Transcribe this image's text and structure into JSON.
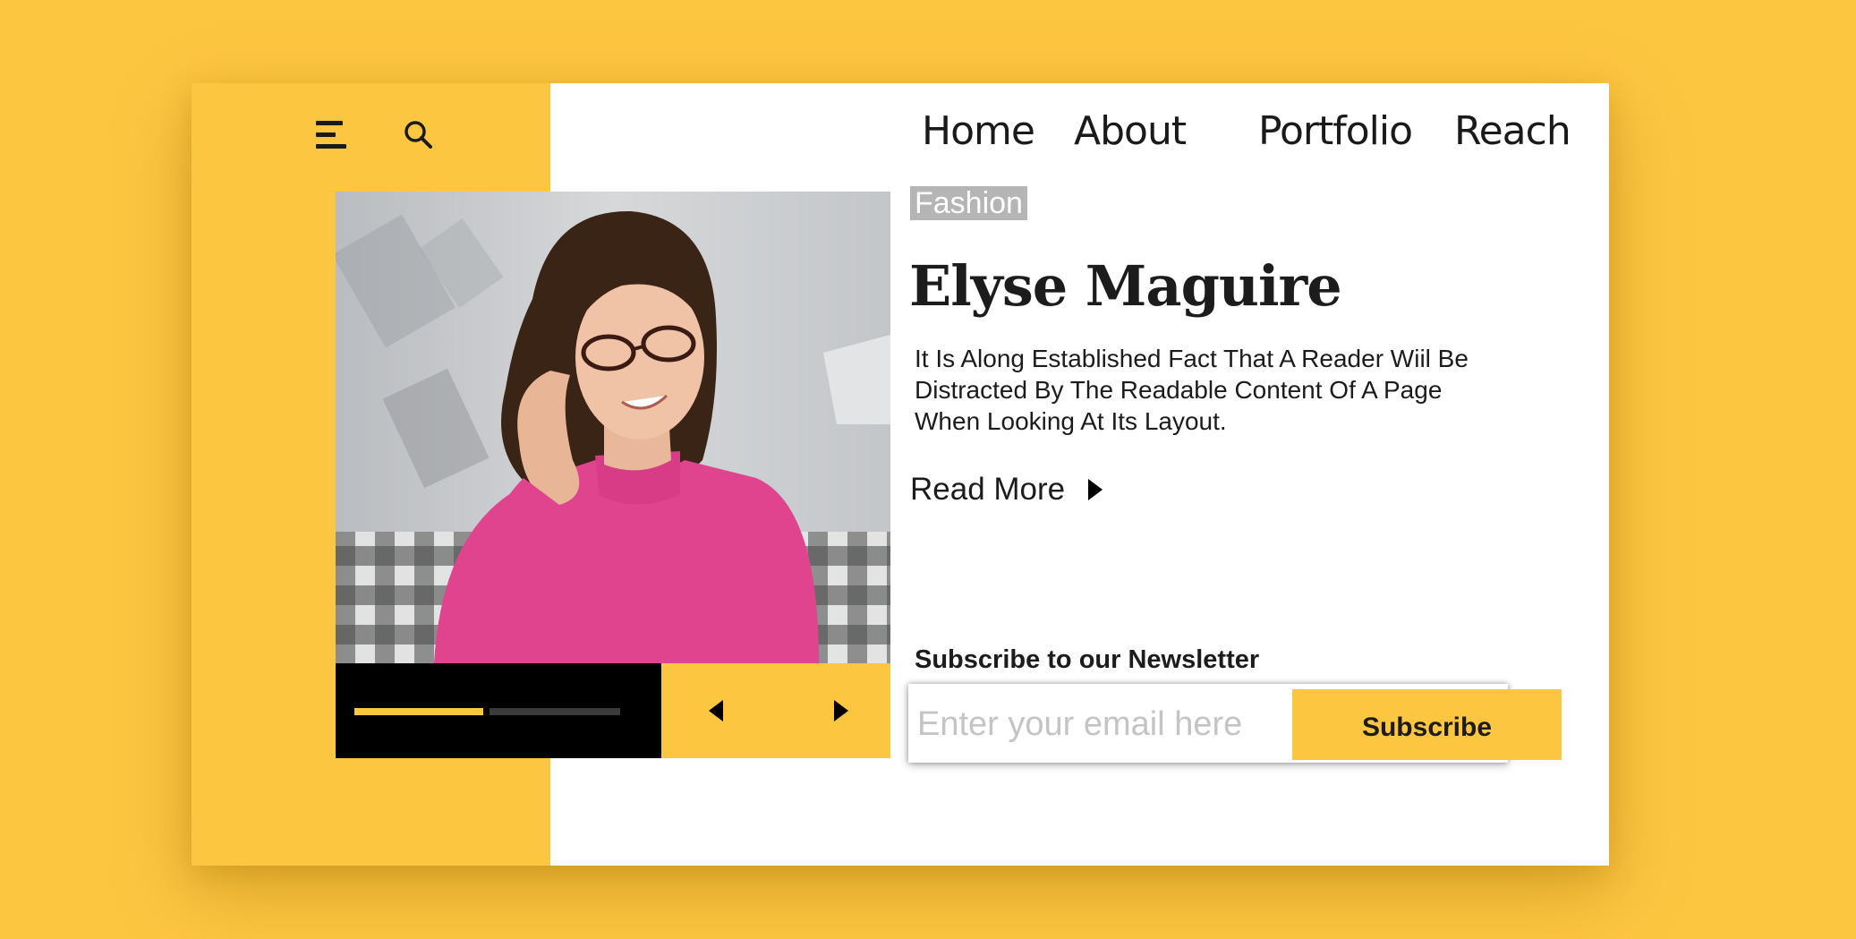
{
  "nav": {
    "items": [
      "Home",
      "About",
      "Portfolio",
      "Reach"
    ]
  },
  "icons": {
    "menu": "hamburger-menu-icon",
    "search": "search-icon",
    "prev": "caret-left-icon",
    "next": "caret-right-icon",
    "read_more": "caret-right-icon"
  },
  "hero": {
    "tag": "Fashion",
    "title": "Elyse Maguire",
    "description": "It Is Along Established Fact That A Reader Wiil Be Distracted By The Readable Content Of A Page When Looking At Its Layout.",
    "read_more_label": "Read More"
  },
  "slider": {
    "progress_segments": 2,
    "active_segment": 1
  },
  "newsletter": {
    "title": "Subscribe to our Newsletter",
    "email_placeholder": "Enter your email here",
    "button_label": "Subscribe"
  },
  "colors": {
    "accent": "#FDC640",
    "text": "#1c1c1c",
    "tag_bg": "#b5b5b5"
  }
}
